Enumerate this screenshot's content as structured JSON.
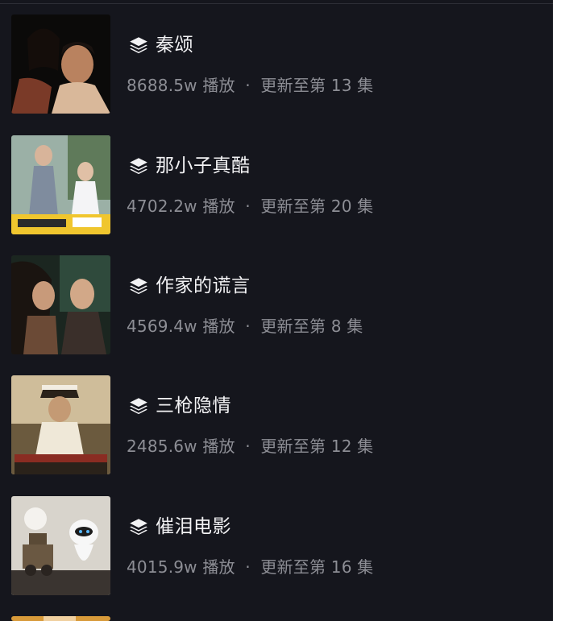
{
  "series_list": [
    {
      "title": "秦颂",
      "plays": "8688.5w",
      "plays_label": "播放",
      "separator": "·",
      "update": "更新至第 13 集",
      "icon": "layers-icon",
      "thumb_palette": [
        "#0b0a09",
        "#7a3a28",
        "#d9b89a"
      ]
    },
    {
      "title": "那小子真酷",
      "plays": "4702.2w",
      "plays_label": "播放",
      "separator": "·",
      "update": "更新至第 20 集",
      "icon": "layers-icon",
      "thumb_palette": [
        "#9bb0a6",
        "#5f7a5a",
        "#f0c62e"
      ]
    },
    {
      "title": "作家的谎言",
      "plays": "4569.4w",
      "plays_label": "播放",
      "separator": "·",
      "update": "更新至第 8 集",
      "icon": "layers-icon",
      "thumb_palette": [
        "#2f4a3c",
        "#1b2620",
        "#c89a7a"
      ]
    },
    {
      "title": "三枪隐情",
      "plays": "2485.6w",
      "plays_label": "播放",
      "separator": "·",
      "update": "更新至第 12 集",
      "icon": "layers-icon",
      "thumb_palette": [
        "#cfbd9a",
        "#6b5a3e",
        "#2a221a"
      ]
    },
    {
      "title": "催泪电影",
      "plays": "4015.9w",
      "plays_label": "播放",
      "separator": "·",
      "update": "更新至第 16 集",
      "icon": "layers-icon",
      "thumb_palette": [
        "#d8d4cc",
        "#6a5842",
        "#3a3430"
      ]
    }
  ]
}
